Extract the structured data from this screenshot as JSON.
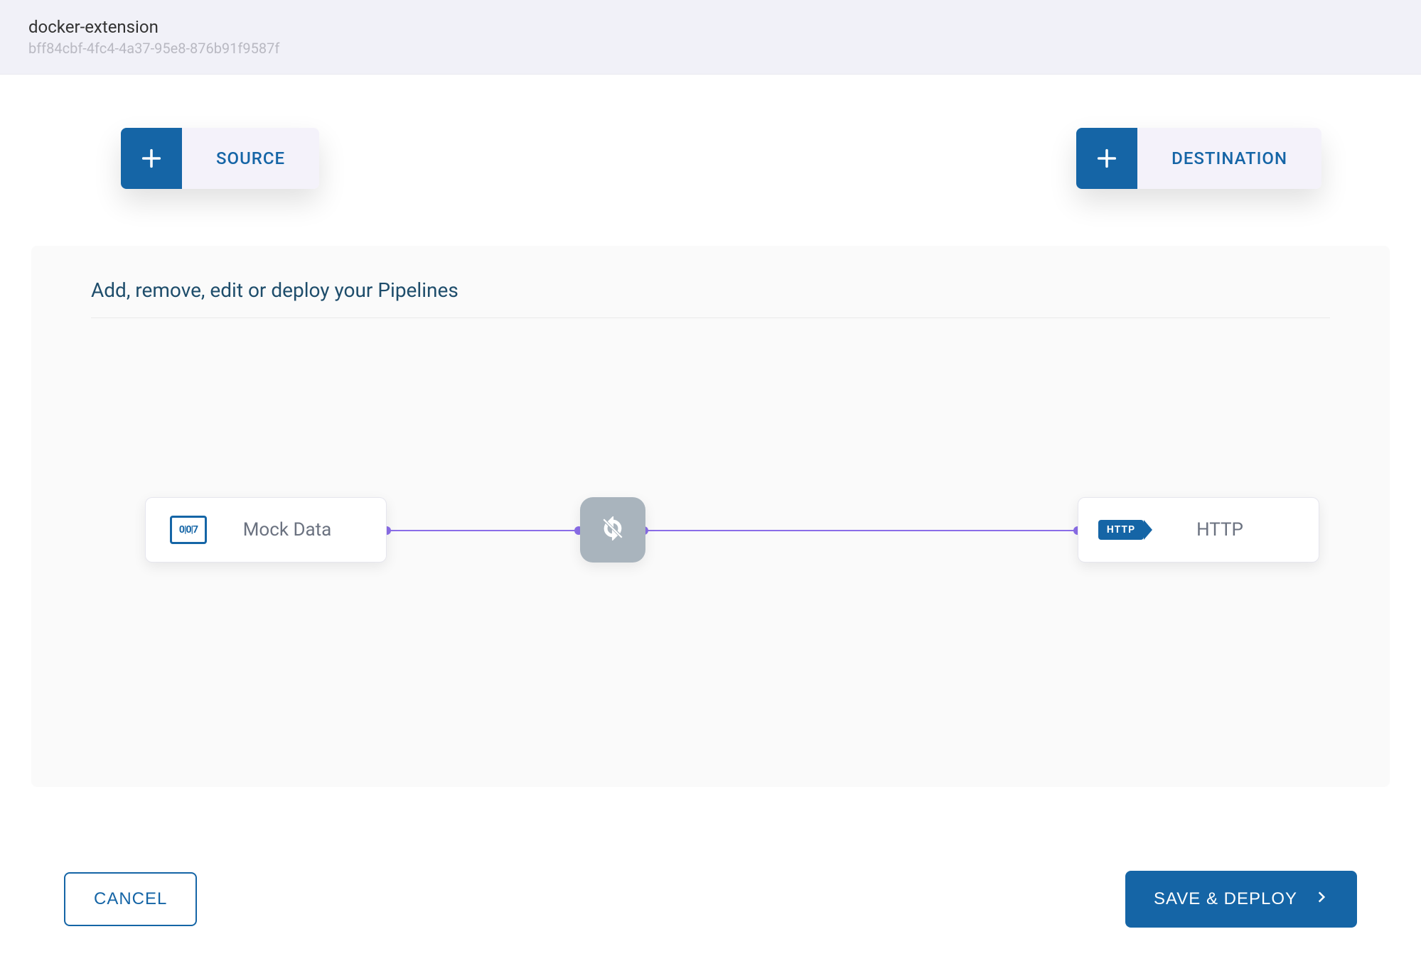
{
  "header": {
    "title": "docker-extension",
    "subtitle": "bff84cbf-4fc4-4a37-95e8-876b91f9587f"
  },
  "toolbar": {
    "source_label": "SOURCE",
    "destination_label": "DESTINATION"
  },
  "canvas": {
    "title": "Add, remove, edit or deploy your Pipelines",
    "source_node": {
      "label": "Mock Data",
      "icon": "mock-data-icon"
    },
    "middle_node": {
      "icon": "sync-disabled-icon"
    },
    "dest_node": {
      "label": "HTTP",
      "badge": "HTTP"
    }
  },
  "footer": {
    "cancel_label": "CANCEL",
    "save_label": "SAVE & DEPLOY"
  },
  "colors": {
    "primary": "#1565a6",
    "wire": "#8a6de8",
    "canvas_bg": "#fafafa",
    "header_bg": "#f1f1f8"
  }
}
